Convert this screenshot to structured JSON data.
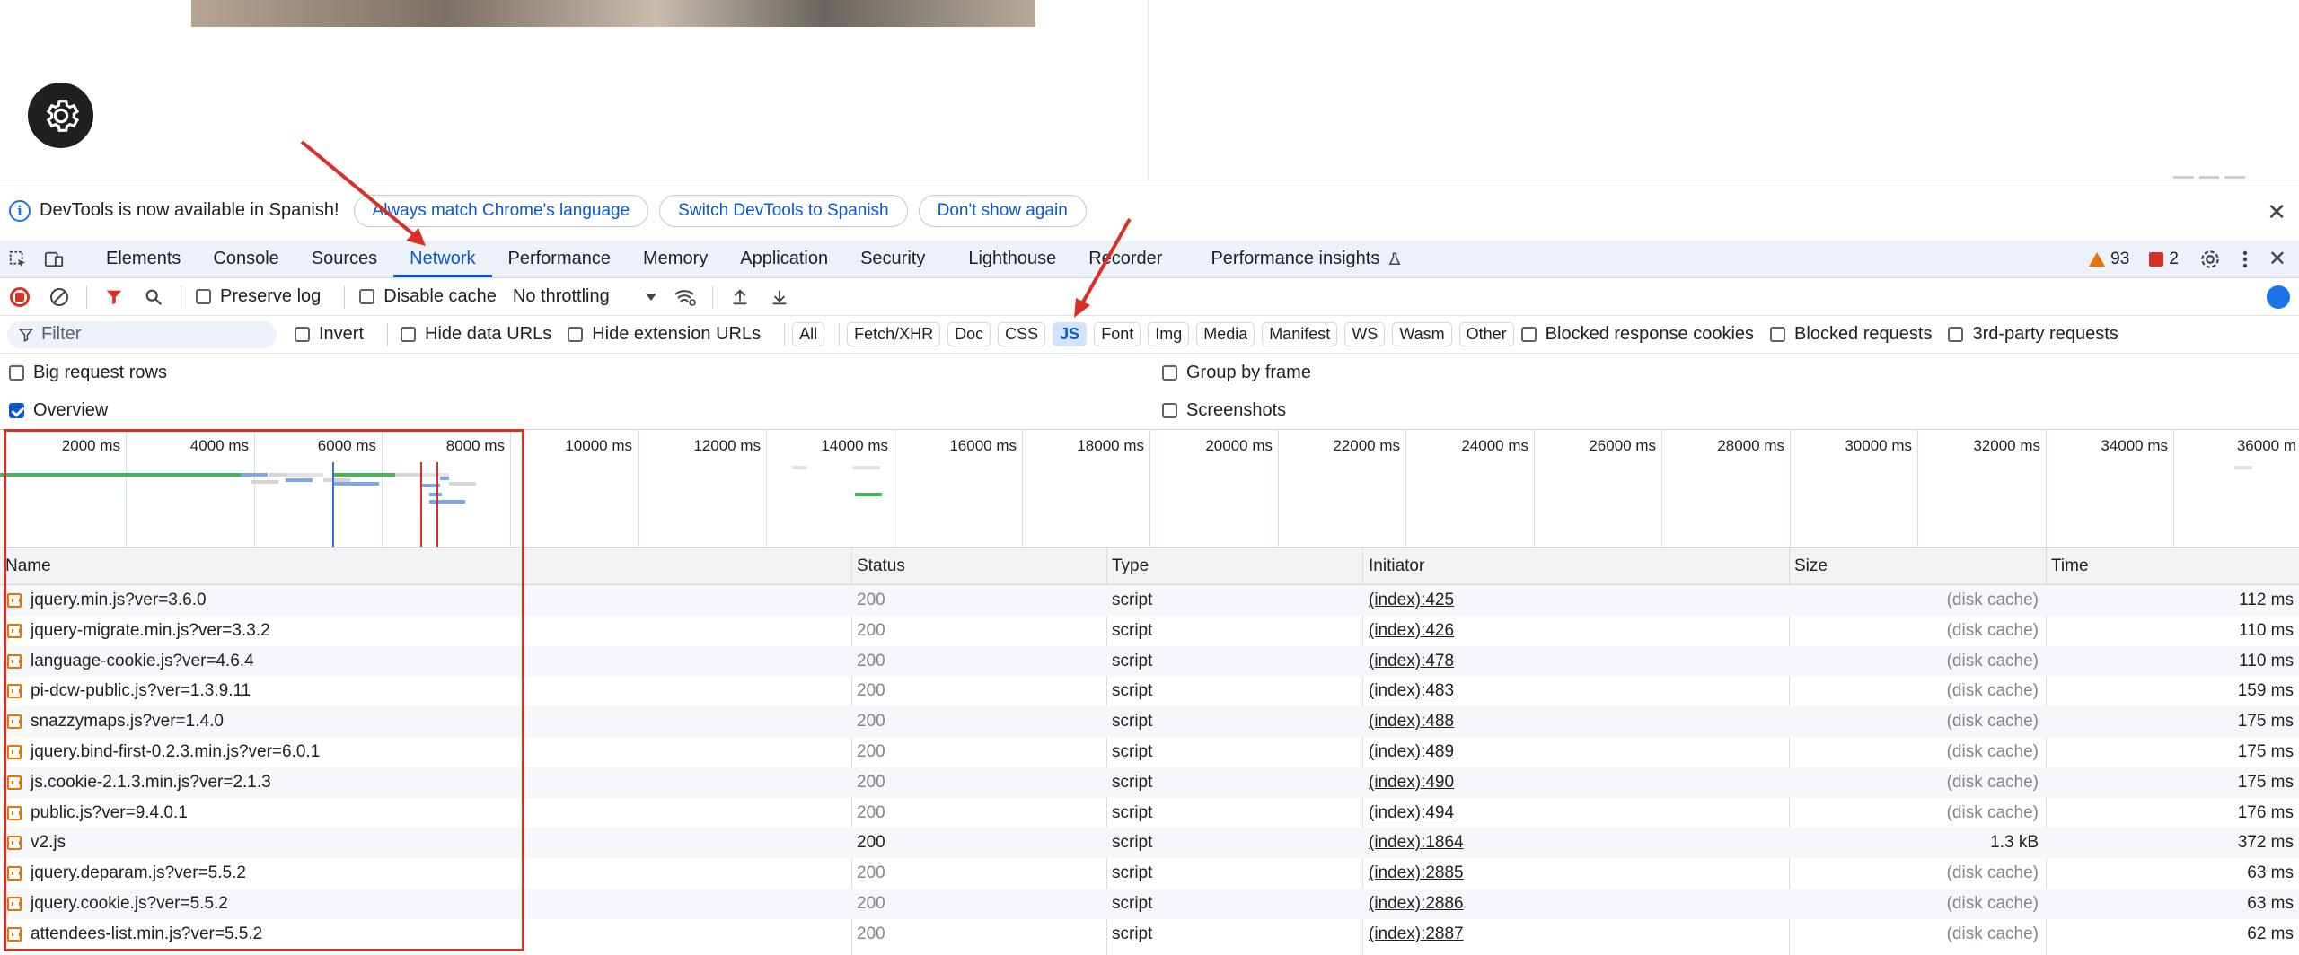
{
  "infobar": {
    "message": "DevTools is now available in Spanish!",
    "buttons": [
      "Always match Chrome's language",
      "Switch DevTools to Spanish",
      "Don't show again"
    ]
  },
  "tabs": [
    "Elements",
    "Console",
    "Sources",
    "Network",
    "Performance",
    "Memory",
    "Application",
    "Security",
    "Lighthouse",
    "Recorder",
    "Performance insights"
  ],
  "active_tab": "Network",
  "status": {
    "warnings": "93",
    "errors": "2"
  },
  "toolbar": {
    "preserve_log": "Preserve log",
    "disable_cache": "Disable cache",
    "throttling": "No throttling"
  },
  "filter": {
    "placeholder": "Filter",
    "invert": "Invert",
    "hide_data_urls": "Hide data URLs",
    "hide_extension_urls": "Hide extension URLs",
    "types": [
      "All",
      "Fetch/XHR",
      "Doc",
      "CSS",
      "JS",
      "Font",
      "Img",
      "Media",
      "Manifest",
      "WS",
      "Wasm",
      "Other"
    ],
    "active_type": "JS",
    "blocked_response_cookies": "Blocked response cookies",
    "blocked_requests": "Blocked requests",
    "third_party": "3rd-party requests"
  },
  "options": {
    "big_request_rows": "Big request rows",
    "overview": "Overview",
    "group_by_frame": "Group by frame",
    "screenshots": "Screenshots"
  },
  "overview": {
    "ticks": [
      "2000 ms",
      "4000 ms",
      "6000 ms",
      "8000 ms",
      "10000 ms",
      "12000 ms",
      "14000 ms",
      "16000 ms",
      "18000 ms",
      "20000 ms",
      "22000 ms",
      "24000 ms",
      "26000 ms",
      "28000 ms",
      "30000 ms",
      "32000 ms",
      "34000 ms",
      "36000 m"
    ]
  },
  "table": {
    "columns": [
      "Name",
      "Status",
      "Type",
      "Initiator",
      "Size",
      "Time"
    ],
    "rows": [
      {
        "name": "jquery.min.js?ver=3.6.0",
        "status": "200",
        "type": "script",
        "initiator": "(index):425",
        "size": "(disk cache)",
        "time": "112 ms"
      },
      {
        "name": "jquery-migrate.min.js?ver=3.3.2",
        "status": "200",
        "type": "script",
        "initiator": "(index):426",
        "size": "(disk cache)",
        "time": "110 ms"
      },
      {
        "name": "language-cookie.js?ver=4.6.4",
        "status": "200",
        "type": "script",
        "initiator": "(index):478",
        "size": "(disk cache)",
        "time": "110 ms"
      },
      {
        "name": "pi-dcw-public.js?ver=1.3.9.11",
        "status": "200",
        "type": "script",
        "initiator": "(index):483",
        "size": "(disk cache)",
        "time": "159 ms"
      },
      {
        "name": "snazzymaps.js?ver=1.4.0",
        "status": "200",
        "type": "script",
        "initiator": "(index):488",
        "size": "(disk cache)",
        "time": "175 ms"
      },
      {
        "name": "jquery.bind-first-0.2.3.min.js?ver=6.0.1",
        "status": "200",
        "type": "script",
        "initiator": "(index):489",
        "size": "(disk cache)",
        "time": "175 ms"
      },
      {
        "name": "js.cookie-2.1.3.min.js?ver=2.1.3",
        "status": "200",
        "type": "script",
        "initiator": "(index):490",
        "size": "(disk cache)",
        "time": "175 ms"
      },
      {
        "name": "public.js?ver=9.4.0.1",
        "status": "200",
        "type": "script",
        "initiator": "(index):494",
        "size": "(disk cache)",
        "time": "176 ms"
      },
      {
        "name": "v2.js",
        "status": "200",
        "type": "script",
        "initiator": "(index):1864",
        "size": "1.3 kB",
        "time": "372 ms"
      },
      {
        "name": "jquery.deparam.js?ver=5.5.2",
        "status": "200",
        "type": "script",
        "initiator": "(index):2885",
        "size": "(disk cache)",
        "time": "63 ms"
      },
      {
        "name": "jquery.cookie.js?ver=5.5.2",
        "status": "200",
        "type": "script",
        "initiator": "(index):2886",
        "size": "(disk cache)",
        "time": "63 ms"
      },
      {
        "name": "attendees-list.min.js?ver=5.5.2",
        "status": "200",
        "type": "script",
        "initiator": "(index):2887",
        "size": "(disk cache)",
        "time": "62 ms"
      }
    ]
  },
  "colors": {
    "accent": "#0b57d0",
    "annotation": "#d93025"
  }
}
